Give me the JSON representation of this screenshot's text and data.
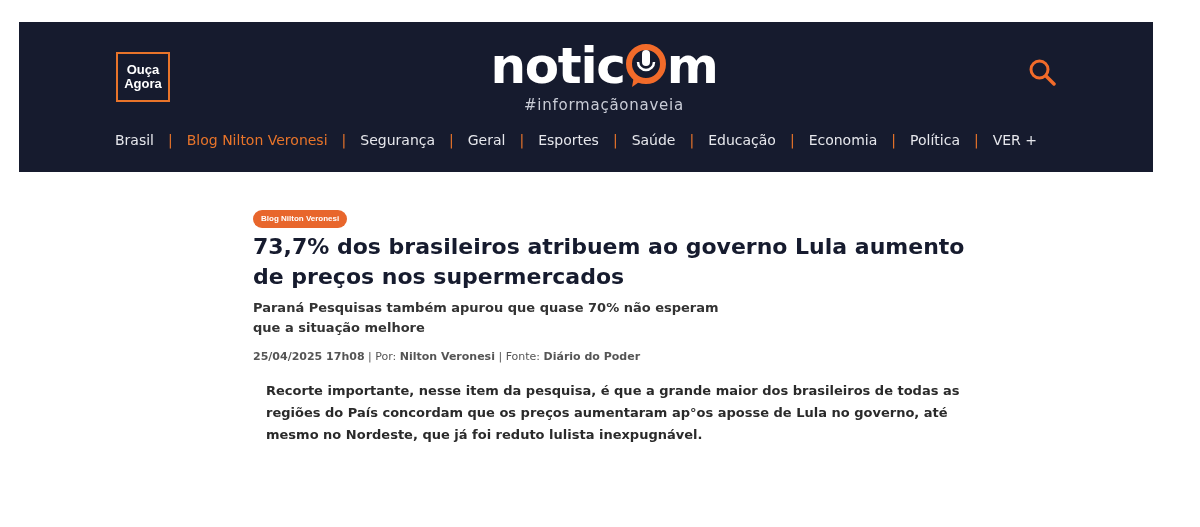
{
  "header": {
    "listen_badge": {
      "line_1": "Ouça",
      "line_2": "Agora"
    },
    "logo": {
      "before_icon": "notic",
      "after_icon": "m",
      "tagline": "#informaçãonaveia"
    }
  },
  "nav": [
    {
      "label": "Brasil",
      "selected": false,
      "separator": "|"
    },
    {
      "label": "Blog Nilton Veronesi",
      "selected": true,
      "separator": "|"
    },
    {
      "label": "Segurança",
      "selected": false,
      "separator": "|"
    },
    {
      "label": "Geral",
      "selected": false,
      "separator": "|"
    },
    {
      "label": "Esportes",
      "selected": false,
      "separator": "|"
    },
    {
      "label": "Saúde",
      "selected": false,
      "separator": "|"
    },
    {
      "label": "Educação",
      "selected": false,
      "separator": "|"
    },
    {
      "label": "Economia",
      "selected": false,
      "separator": "|"
    },
    {
      "label": "Política",
      "selected": false,
      "separator": "|"
    },
    {
      "label": "VER +",
      "selected": false
    }
  ],
  "article": {
    "category": "Blog Nilton Veronesi",
    "title": "73,7% dos brasileiros atribuem ao governo Lula aumento de preços nos supermercados",
    "subtitle": "Paraná Pesquisas também apurou que quase 70% não esperam que a situação melhore",
    "meta": "**25/04/2025 17h08** | Por: **Nilton Veronesi** | Fonte: **Diário do Poder**",
    "lead": "Recorte importante, nesse item da pesquisa, é que a grande maior dos brasileiros de todas as regiões do País concordam que os preços aumentaram ap°os aposse de Lula no governo, até mesmo no Nordeste, que já foi reduto lulista inexpugnável."
  }
}
